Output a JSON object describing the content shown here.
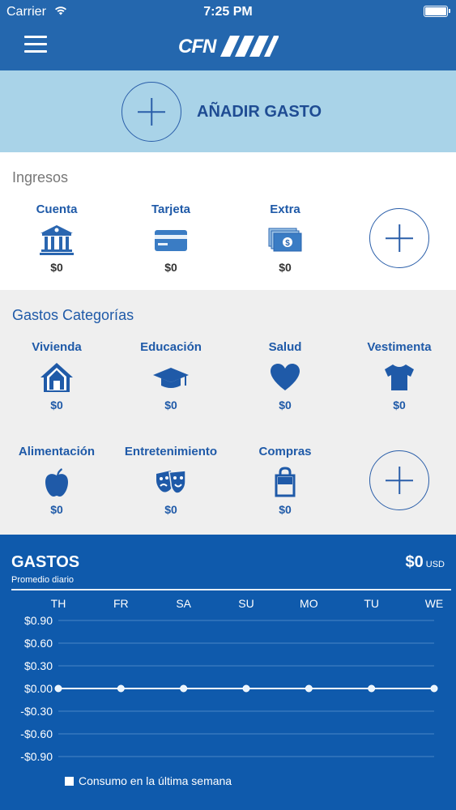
{
  "status": {
    "carrier": "Carrier",
    "time": "7:25 PM"
  },
  "header": {
    "logo_text": "CFN"
  },
  "add_expense": {
    "label": "AÑADIR GASTO"
  },
  "ingresos": {
    "title": "Ingresos",
    "items": [
      {
        "name": "Cuenta",
        "amount": "$0",
        "icon": "bank-icon"
      },
      {
        "name": "Tarjeta",
        "amount": "$0",
        "icon": "credit-card-icon"
      },
      {
        "name": "Extra",
        "amount": "$0",
        "icon": "cash-icon"
      }
    ]
  },
  "gastos_categorias": {
    "title": "Gastos Categorías",
    "items": [
      {
        "name": "Vivienda",
        "amount": "$0",
        "icon": "house-icon"
      },
      {
        "name": "Educación",
        "amount": "$0",
        "icon": "graduation-cap-icon"
      },
      {
        "name": "Salud",
        "amount": "$0",
        "icon": "heart-icon"
      },
      {
        "name": "Vestimenta",
        "amount": "$0",
        "icon": "tshirt-icon"
      },
      {
        "name": "Alimentación",
        "amount": "$0",
        "icon": "apple-icon"
      },
      {
        "name": "Entretenimiento",
        "amount": "$0",
        "icon": "theater-masks-icon"
      },
      {
        "name": "Compras",
        "amount": "$0",
        "icon": "shopping-bag-icon"
      }
    ]
  },
  "gastos": {
    "title": "GASTOS",
    "subtitle": "Promedio diario",
    "total": "$0",
    "currency": "USD"
  },
  "colors": {
    "brand": "#2467ae",
    "accent": "#1f5aa8",
    "chart_bg": "#0f5aac",
    "banner": "#a9d3e8"
  },
  "chart_data": {
    "type": "line",
    "categories": [
      "TH",
      "FR",
      "SA",
      "SU",
      "MO",
      "TU",
      "WE"
    ],
    "y_ticks": [
      "$0.90",
      "$0.60",
      "$0.30",
      "$0.00",
      "-$0.30",
      "-$0.60",
      "-$0.90"
    ],
    "ylim": [
      -0.9,
      0.9
    ],
    "series": [
      {
        "name": "Consumo en la última semana",
        "values": [
          0,
          0,
          0,
          0,
          0,
          0,
          0
        ]
      }
    ],
    "grid": true,
    "legend": "bottom"
  }
}
